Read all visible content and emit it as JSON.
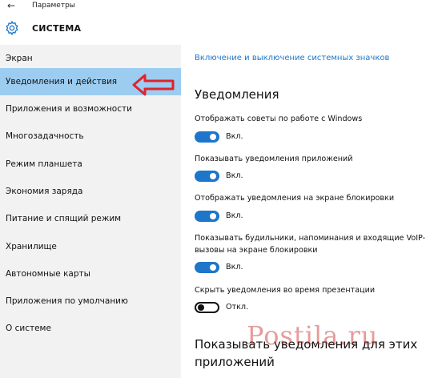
{
  "titlebar": {
    "app_title": "Параметры"
  },
  "header": {
    "title": "СИСТЕМА"
  },
  "sidebar": {
    "items": [
      {
        "label": "Экран"
      },
      {
        "label": "Уведомления и действия"
      },
      {
        "label": "Приложения и возможности"
      },
      {
        "label": "Многозадачность"
      },
      {
        "label": "Режим планшета"
      },
      {
        "label": "Экономия заряда"
      },
      {
        "label": "Питание и спящий режим"
      },
      {
        "label": "Хранилище"
      },
      {
        "label": "Автономные карты"
      },
      {
        "label": "Приложения по умолчанию"
      },
      {
        "label": "О системе"
      }
    ],
    "active_index": 1
  },
  "content": {
    "link": "Включение и выключение системных значков",
    "section_title": "Уведомления",
    "settings": [
      {
        "label": "Отображать советы по работе с Windows",
        "state": "Вкл.",
        "on": true
      },
      {
        "label": "Показывать уведомления приложений",
        "state": "Вкл.",
        "on": true
      },
      {
        "label": "Отображать уведомления на экране блокировки",
        "state": "Вкл.",
        "on": true
      },
      {
        "label_line1": "Показывать будильники, напоминания и входящие VoIP-",
        "label_line2": "вызовы на экране блокировки",
        "state": "Вкл.",
        "on": true
      },
      {
        "label": "Скрыть уведомления во время презентации",
        "state": "Откл.",
        "on": false
      }
    ],
    "section_title2_line1": "Показывать уведомления для этих",
    "section_title2_line2": "приложений"
  },
  "watermark": {
    "text": "Postila.ru"
  },
  "colors": {
    "accent": "#1d76c9",
    "active_item": "#9ccdf1",
    "sidebar_bg": "#f2f2f2",
    "annotation_arrow": "#e0242c"
  },
  "icons": {
    "back": "back-arrow-icon",
    "settings": "gear-icon",
    "annotation": "red-arrow-icon"
  }
}
